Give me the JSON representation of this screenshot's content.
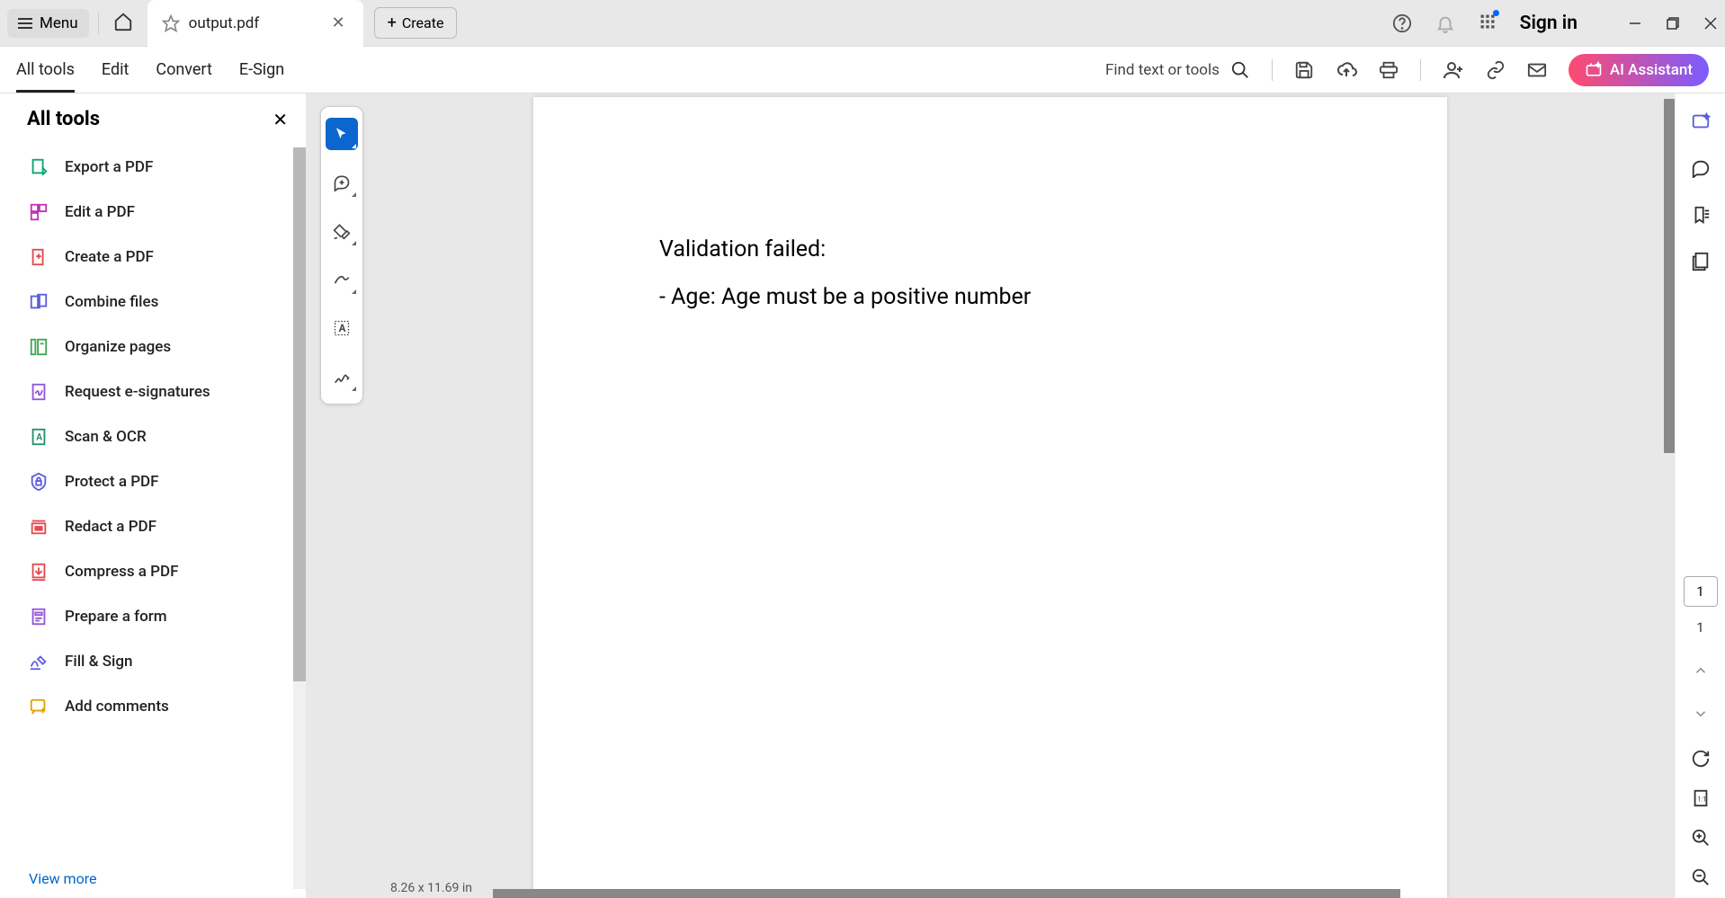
{
  "titlebar": {
    "menu_label": "Menu",
    "tab_title": "output.pdf",
    "create_label": "Create",
    "sign_in": "Sign in"
  },
  "nav": {
    "tabs": [
      "All tools",
      "Edit",
      "Convert",
      "E-Sign"
    ],
    "search_label": "Find text or tools",
    "ai_label": "AI Assistant"
  },
  "panel": {
    "title": "All tools",
    "items": [
      {
        "label": "Export a PDF",
        "color": "#0aa36e"
      },
      {
        "label": "Edit a PDF",
        "color": "#c233b8"
      },
      {
        "label": "Create a PDF",
        "color": "#e34850"
      },
      {
        "label": "Combine files",
        "color": "#5c5ce0"
      },
      {
        "label": "Organize pages",
        "color": "#3da74e"
      },
      {
        "label": "Request e-signatures",
        "color": "#9256d9"
      },
      {
        "label": "Scan & OCR",
        "color": "#268e6c"
      },
      {
        "label": "Protect a PDF",
        "color": "#5c5ce0"
      },
      {
        "label": "Redact a PDF",
        "color": "#e34850"
      },
      {
        "label": "Compress a PDF",
        "color": "#e34850"
      },
      {
        "label": "Prepare a form",
        "color": "#9256d9"
      },
      {
        "label": "Fill & Sign",
        "color": "#5c5ce0"
      },
      {
        "label": "Add comments",
        "color": "#e2a100"
      }
    ],
    "view_more": "View more"
  },
  "document": {
    "line1": "Validation failed:",
    "line2": "- Age: Age must be a positive number",
    "dimensions": "8.26 x 11.69 in"
  },
  "page_nav": {
    "current": "1",
    "total": "1"
  }
}
